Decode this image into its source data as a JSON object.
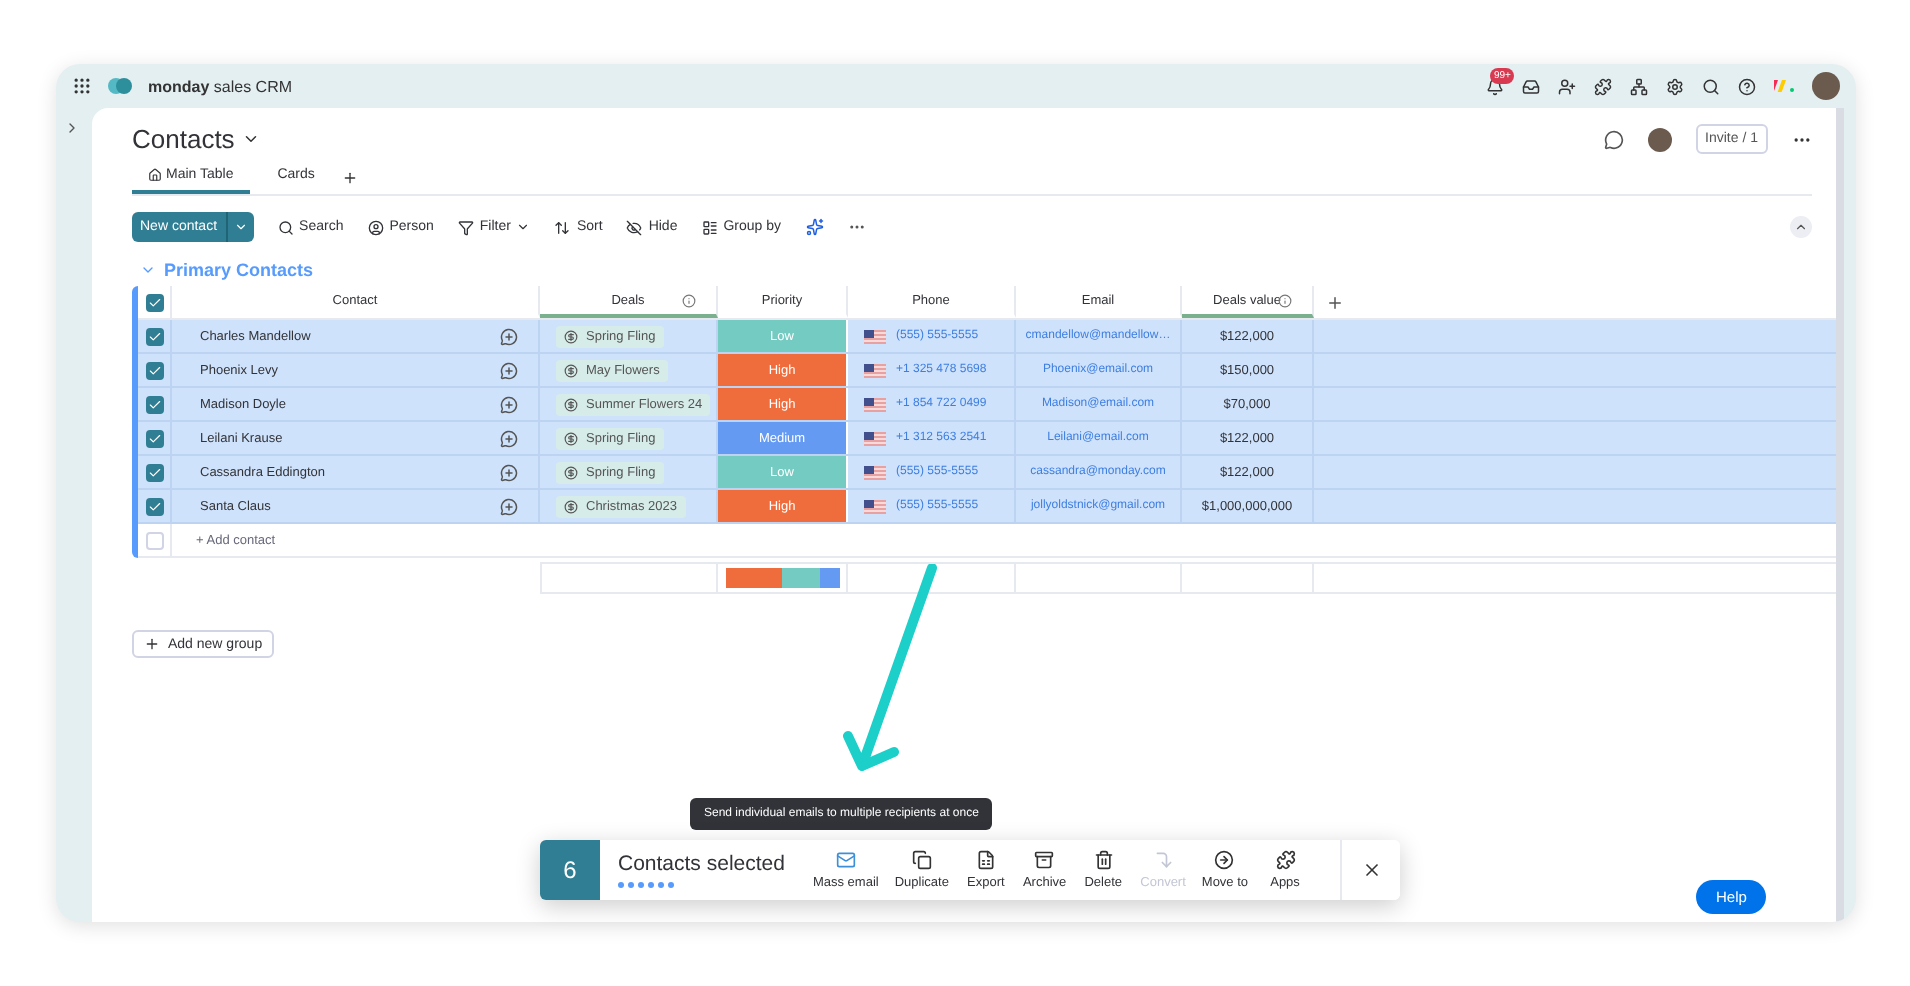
{
  "app": {
    "brand": "monday",
    "product": "sales CRM",
    "notification_badge": "99+"
  },
  "board": {
    "title": "Contacts",
    "invite": "Invite / 1"
  },
  "tabs": [
    {
      "label": "Main Table",
      "selected": true
    },
    {
      "label": "Cards",
      "selected": false
    }
  ],
  "toolbar": {
    "primary": "New contact",
    "items": [
      "Search",
      "Person",
      "Filter",
      "Sort",
      "Hide",
      "Group by"
    ]
  },
  "group": {
    "title": "Primary Contacts",
    "expanded": true
  },
  "table": {
    "all_selected": true,
    "columns": [
      {
        "label": "Contact",
        "info": false
      },
      {
        "label": "Deals",
        "info": true
      },
      {
        "label": "Priority",
        "info": false
      },
      {
        "label": "Phone",
        "info": false
      },
      {
        "label": "Email",
        "info": false
      },
      {
        "label": "Deals value",
        "info": true
      }
    ],
    "rows": [
      {
        "checked": true,
        "contact": "Charles Mandellow",
        "deal": "Spring Fling",
        "priority": {
          "label": "Low",
          "color": "#74cbc2"
        },
        "phone": "(555) 555-5555",
        "email": "cmandellow@mandellow…",
        "value": "$122,000"
      },
      {
        "checked": true,
        "contact": "Phoenix Levy",
        "deal": "May Flowers",
        "priority": {
          "label": "High",
          "color": "#ef6d3c"
        },
        "phone": "+1 325 478 5698",
        "email": "Phoenix@email.com",
        "value": "$150,000"
      },
      {
        "checked": true,
        "contact": "Madison Doyle",
        "deal": "Summer Flowers 24",
        "priority": {
          "label": "High",
          "color": "#ef6d3c"
        },
        "phone": "+1 854 722 0499",
        "email": "Madison@email.com",
        "value": "$70,000"
      },
      {
        "checked": true,
        "contact": "Leilani Krause",
        "deal": "Spring Fling",
        "priority": {
          "label": "Medium",
          "color": "#649af2"
        },
        "phone": "+1 312 563 2541",
        "email": "Leilani@email.com",
        "value": "$122,000"
      },
      {
        "checked": true,
        "contact": "Cassandra Eddington",
        "deal": "Spring Fling",
        "priority": {
          "label": "Low",
          "color": "#74cbc2"
        },
        "phone": "(555) 555-5555",
        "email": "cassandra@monday.com",
        "value": "$122,000"
      },
      {
        "checked": true,
        "contact": "Santa Claus",
        "deal": "Christmas 2023",
        "priority": {
          "label": "High",
          "color": "#ef6d3c"
        },
        "phone": "(555) 555-5555",
        "email": "jollyoldstnick@gmail.com",
        "value": "$1,000,000,000"
      }
    ],
    "add_row": {
      "label": "+ Add contact",
      "checked": false
    }
  },
  "add_group": "Add new group",
  "selection_bar": {
    "count": "6",
    "label": "Contacts selected",
    "actions": [
      {
        "label": "Mass email",
        "highlighted": true,
        "disabled": false
      },
      {
        "label": "Duplicate",
        "highlighted": false,
        "disabled": false
      },
      {
        "label": "Export",
        "highlighted": false,
        "disabled": false
      },
      {
        "label": "Archive",
        "highlighted": false,
        "disabled": false
      },
      {
        "label": "Delete",
        "highlighted": false,
        "disabled": false
      },
      {
        "label": "Convert",
        "highlighted": false,
        "disabled": true
      },
      {
        "label": "Move to",
        "highlighted": false,
        "disabled": false
      },
      {
        "label": "Apps",
        "highlighted": false,
        "disabled": false
      }
    ]
  },
  "tooltip": "Send individual emails to multiple recipients at once",
  "help": "Help"
}
